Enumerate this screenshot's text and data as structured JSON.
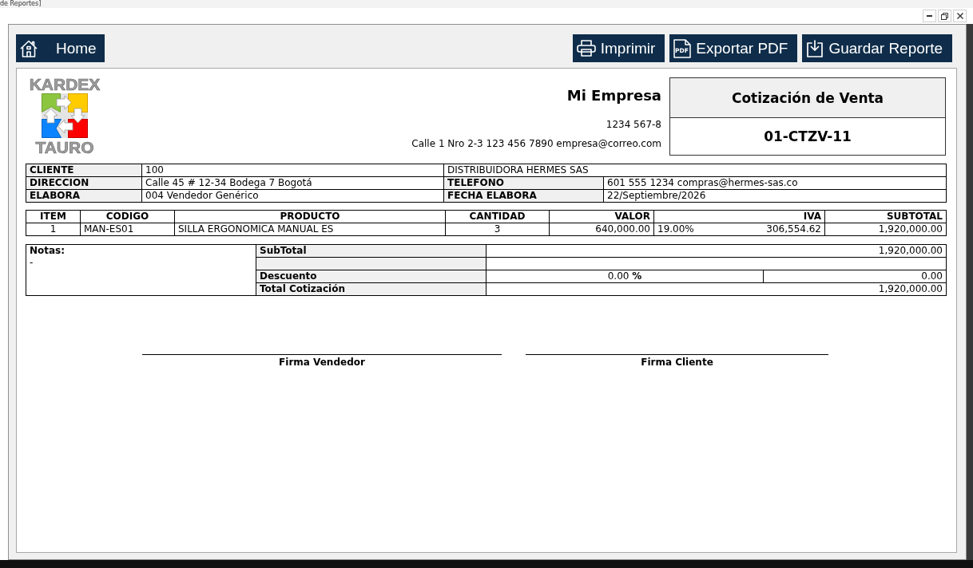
{
  "window": {
    "title": "de Reportes]"
  },
  "toolbar": {
    "home": {
      "label": "Home"
    },
    "actions": [
      {
        "kind": "print",
        "label": "Imprimir"
      },
      {
        "kind": "pdf",
        "label": "Exportar PDF",
        "icon_text": "PDF"
      },
      {
        "kind": "save",
        "label": "Guardar Reporte"
      }
    ]
  },
  "report": {
    "logo": {
      "top_text": "KARDEX",
      "bottom_text": "TAURO"
    },
    "company": {
      "name": "Mi Empresa",
      "id": "1234 567-8",
      "contact": "Calle 1 Nro 2-3 123 456 7890 empresa@correo.com"
    },
    "document": {
      "title": "Cotización de Venta",
      "number": "01-CTZV-11"
    },
    "client_info": [
      {
        "label": "CLIENTE",
        "value": "100",
        "value_2": "DISTRIBUIDORA HERMES SAS"
      },
      {
        "label": "DIRECCION",
        "value": "Calle 45 # 12-34 Bodega 7 Bogotá",
        "label_2": "TELEFONO",
        "value_2": "601 555 1234 compras@hermes-sas.co"
      },
      {
        "label": "ELABORA",
        "value": "004 Vendedor Genérico",
        "label_2": "FECHA ELABORA",
        "value_2": "22/Septiembre/2026"
      }
    ],
    "items": {
      "columns": [
        "ITEM",
        "CODIGO",
        "PRODUCTO",
        "CANTIDAD",
        "VALOR",
        "IVA",
        "SUBTOTAL"
      ],
      "rows": [
        {
          "item": "1",
          "code": "MAN-ES01",
          "product": "SILLA ERGONOMICA MANUAL ES",
          "quantity": "3",
          "unit_value": "640,000.00",
          "tax_rate": "19.00%",
          "tax": "306,554.62",
          "subtotal": "1,920,000.00"
        }
      ]
    },
    "totals": {
      "notes_label": "Notas:",
      "notes": "-",
      "rows": [
        {
          "kind": "amount",
          "label": "SubTotal",
          "value": "1,920,000.00"
        },
        {
          "kind": "blank"
        },
        {
          "kind": "discount",
          "label": "Descuento",
          "rate": "0.00 **%**",
          "value": "0.00"
        },
        {
          "kind": "amount",
          "label": "Total Cotización",
          "value": "1,920,000.00"
        }
      ]
    },
    "signatures": [
      {
        "label": "Firma Vendedor"
      },
      {
        "label": "Firma Cliente"
      }
    ]
  }
}
